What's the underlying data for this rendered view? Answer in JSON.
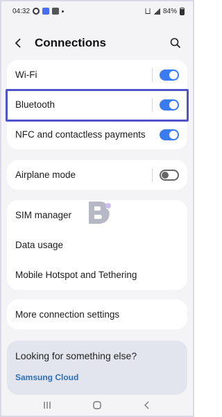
{
  "status_bar": {
    "time": "04:32",
    "battery": "84%",
    "icons": [
      "whatsapp-icon",
      "gallery-icon",
      "calendar-icon",
      "notification-dot",
      "wifi-icon",
      "signal-icon",
      "battery-icon"
    ]
  },
  "header": {
    "title": "Connections",
    "back_icon": "back-arrow-icon",
    "search_icon": "search-icon"
  },
  "group1": [
    {
      "label": "Wi-Fi",
      "toggle": true,
      "divider": true
    },
    {
      "label": "Bluetooth",
      "toggle": true,
      "divider": true,
      "highlighted": true
    },
    {
      "label": "NFC and contactless payments",
      "toggle": true,
      "divider": false
    }
  ],
  "group2": [
    {
      "label": "Airplane mode",
      "toggle": false,
      "divider": true
    }
  ],
  "group3": [
    {
      "label": "SIM manager"
    },
    {
      "label": "Data usage"
    },
    {
      "label": "Mobile Hotspot and Tethering"
    }
  ],
  "group4": [
    {
      "label": "More connection settings"
    }
  ],
  "suggestion": {
    "title": "Looking for something else?",
    "link": "Samsung Cloud"
  },
  "colors": {
    "accent": "#3a7bf0",
    "highlight": "#4f55c9",
    "link": "#2e6fb8",
    "background": "#f4f4f7"
  }
}
